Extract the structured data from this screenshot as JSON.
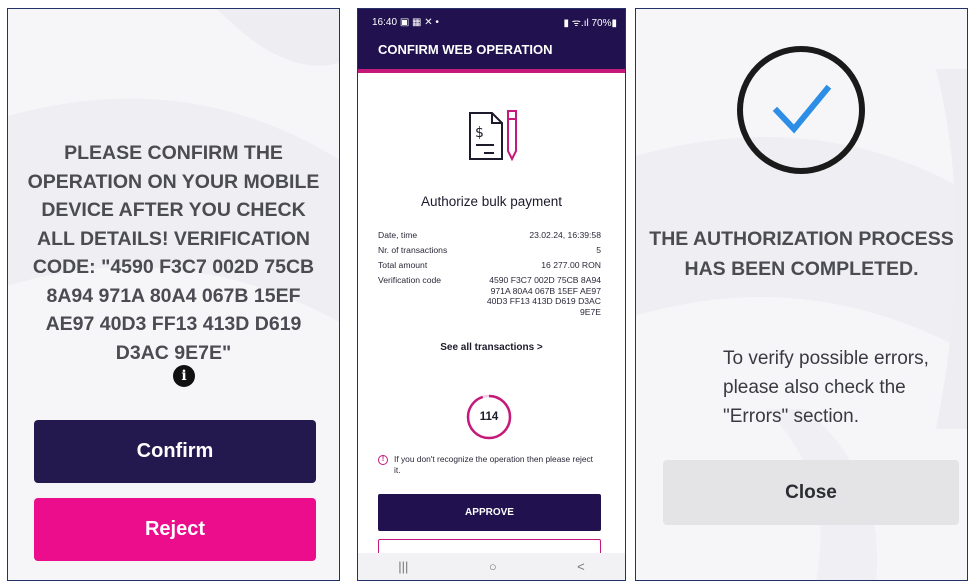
{
  "panel1": {
    "message": "PLEASE CONFIRM THE OPERATION ON YOUR MOBILE DEVICE AFTER YOU CHECK ALL DETAILS! VERIFICATION CODE: \"4590 F3C7 002D 75CB 8A94 971A 80A4 067B 15EF AE97 40D3 FF13 413D D619 D3AC 9E7E\"",
    "info_icon": "info-icon",
    "confirm_label": "Confirm",
    "reject_label": "Reject"
  },
  "phone": {
    "status_time": "16:40",
    "status_icons": "▣ ▦ ✕ •",
    "status_right": "▮ ᯤ.ıl 70%▮",
    "app_title": "CONFIRM WEB OPERATION",
    "auth_title": "Authorize bulk payment",
    "details": [
      {
        "label": "Date, time",
        "value": "23.02.24, 16:39:58"
      },
      {
        "label": "Nr. of transactions",
        "value": "5"
      },
      {
        "label": "Total amount",
        "value": "16 277.00 RON"
      }
    ],
    "code_label": "Verification code",
    "code_value": "4590 F3C7 002D 75CB 8A94 971A 80A4 067B 15EF AE97 40D3 FF13 413D D619 D3AC 9E7E",
    "see_all": "See all transactions  >",
    "timer": "114",
    "timer_fraction": 0.95,
    "warning": "If you don't recognize the operation then please reject it.",
    "approve_label": "APPROVE",
    "nav_back": "<",
    "nav_home": "○",
    "nav_recent": "|||"
  },
  "panel3": {
    "title": "THE AUTHORIZATION PROCESS HAS BEEN COMPLETED.",
    "verify_text": "To verify possible errors, please also check the \"Errors\" section.",
    "close_label": "Close"
  },
  "colors": {
    "navy": "#23194f",
    "magenta": "#ec0d8c",
    "check_blue": "#2c8ee6",
    "border": "#24326b"
  }
}
